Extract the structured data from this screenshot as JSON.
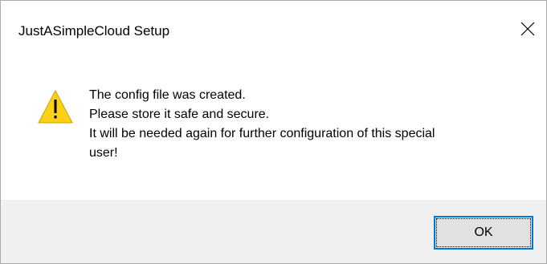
{
  "window": {
    "title": "JustASimpleCloud Setup",
    "close_icon": "close-icon"
  },
  "message": {
    "icon": "warning-icon",
    "lines": [
      "The config file was created.",
      "Please store it safe and secure.",
      "It will be needed again for further configuration of this special",
      "user!"
    ]
  },
  "buttons": {
    "ok_label": "OK"
  },
  "colors": {
    "accent": "#0078d7",
    "warning_yellow": "#fcd116",
    "button_bar": "#f0f0f0",
    "button_face": "#e1e1e1"
  }
}
